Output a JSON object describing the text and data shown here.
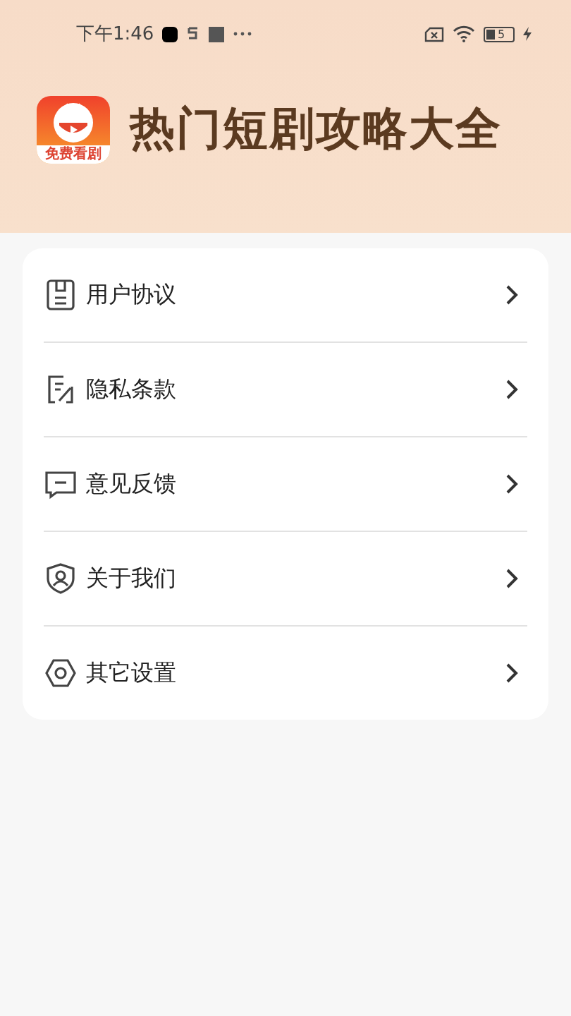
{
  "status_bar": {
    "time": "下午1:46",
    "battery": "5"
  },
  "header": {
    "app_icon_label": "免费看剧",
    "title": "热门短剧攻略大全"
  },
  "menu": [
    {
      "kind": "agreement",
      "label": "用户协议"
    },
    {
      "kind": "privacy",
      "label": "隐私条款"
    },
    {
      "kind": "feedback",
      "label": "意见反馈"
    },
    {
      "kind": "about",
      "label": "关于我们"
    },
    {
      "kind": "settings",
      "label": "其它设置"
    }
  ]
}
